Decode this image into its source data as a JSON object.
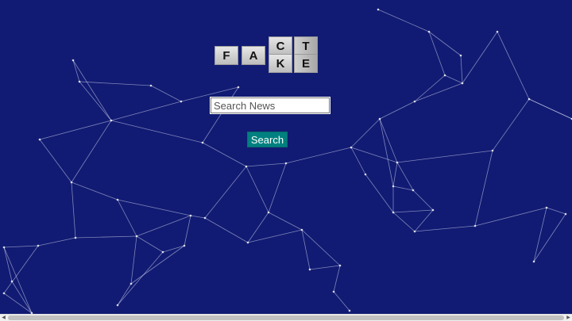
{
  "logo": {
    "top_row": [
      "F",
      "A",
      "C",
      "T"
    ],
    "bottom_row": [
      "K",
      "E"
    ],
    "alt": "FACT FAKE"
  },
  "search": {
    "placeholder": "Search News",
    "value": "",
    "button_label": "Search"
  },
  "colors": {
    "background": "#111b73",
    "button": "#008080",
    "network_lines": "#d8dcf5"
  },
  "icons": {
    "scroll_left": "scroll-left-arrow-icon",
    "scroll_right": "scroll-right-arrow-icon"
  }
}
